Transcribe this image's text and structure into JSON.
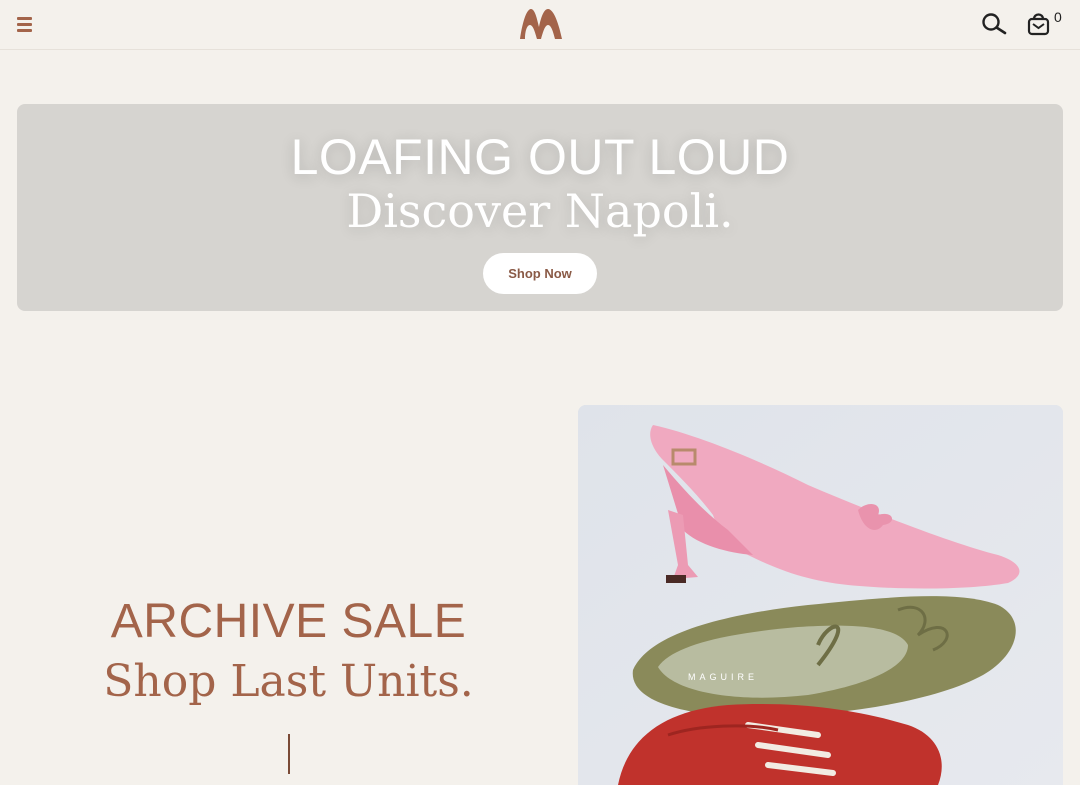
{
  "header": {
    "menu_icon": "hamburger-menu-icon",
    "logo_icon": "brand-logo-icon",
    "search_icon": "search-icon",
    "cart_icon": "shopping-bag-icon",
    "cart_count": "0"
  },
  "hero": {
    "title": "LOAFING OUT LOUD",
    "subtitle": "Discover Napoli.",
    "button_label": "Shop Now"
  },
  "promo": {
    "title": "ARCHIVE SALE",
    "subtitle": "Shop Last Units.",
    "image_text": "MAGUIRE"
  },
  "colors": {
    "accent": "#a3644a",
    "background": "#f4f1ec",
    "hero_bg": "#d6d4d0"
  }
}
